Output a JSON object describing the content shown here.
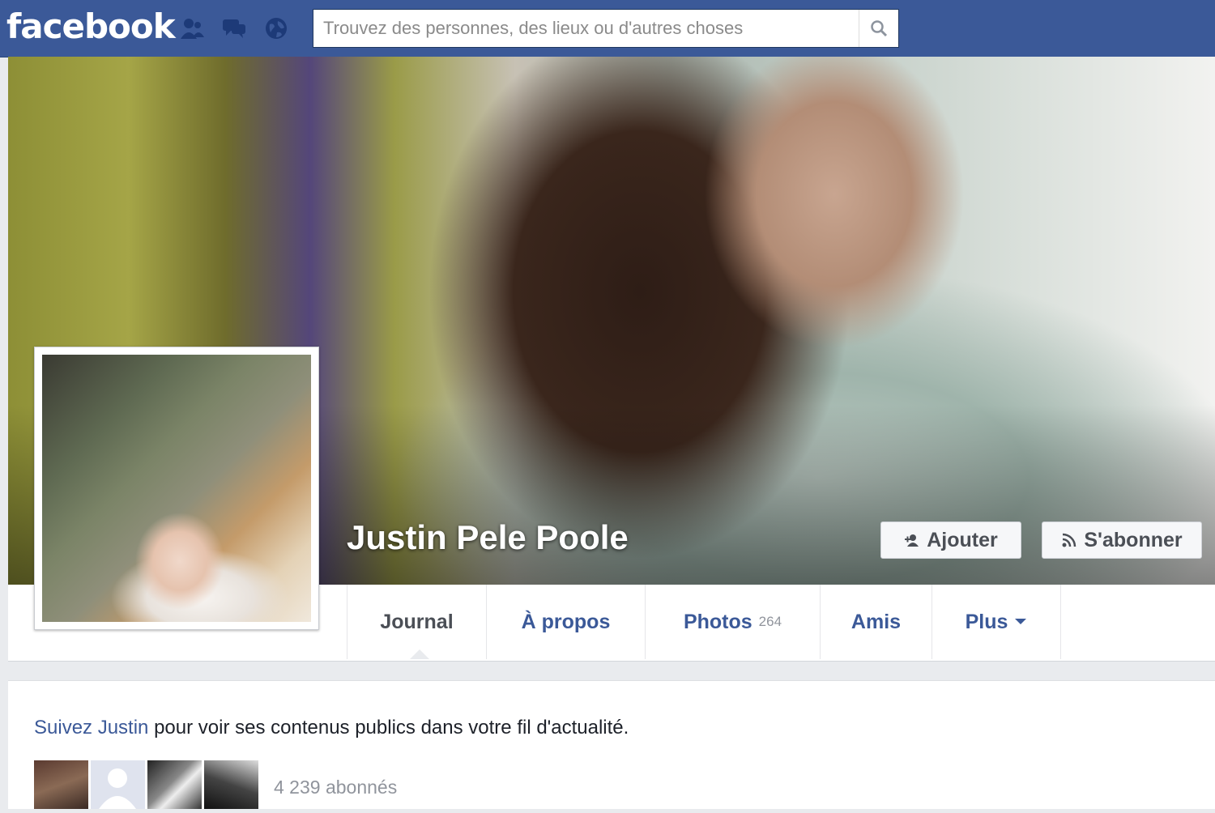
{
  "topbar": {
    "logo": "facebook",
    "search_placeholder": "Trouvez des personnes, des lieux ou d'autres choses",
    "icons": [
      "friend-requests-icon",
      "messages-icon",
      "notifications-globe-icon",
      "search-icon"
    ]
  },
  "profile": {
    "name": "Justin Pele Poole",
    "add_button": "Ajouter",
    "subscribe_button": "S'abonner"
  },
  "tabs": [
    {
      "label": "Journal",
      "active": true
    },
    {
      "label": "À propos"
    },
    {
      "label": "Photos",
      "count": "264"
    },
    {
      "label": "Amis"
    },
    {
      "label": "Plus"
    }
  ],
  "follow_panel": {
    "link_text": "Suivez Justin",
    "rest_text": " pour voir ses contenus publics dans votre fil d'actualité.",
    "followers": "4 239 abonnés"
  },
  "colors": {
    "brand_blue": "#3b5998",
    "link_blue": "#3b5998",
    "page_bg": "#e9ebee"
  }
}
